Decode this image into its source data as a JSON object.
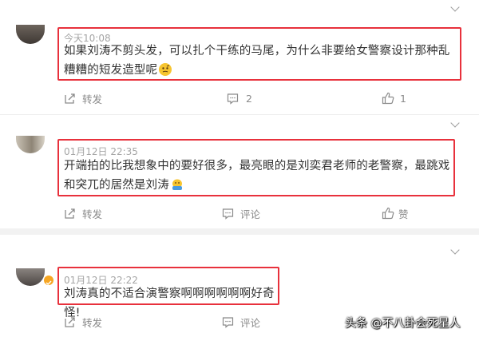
{
  "comments": [
    {
      "time": "今天10:08",
      "text": "如果刘涛不剪头发，可以扎个干练的马尾，为什么非要给女警察设计那种乱糟糟的短发造型呢",
      "emoji": "thinking-face",
      "actions": {
        "forward": "转发",
        "comment": "2",
        "like": "1"
      }
    },
    {
      "time": "01月12日 22:35",
      "text": "开端拍的比我想象中的要好很多，最亮眼的是刘奕君老师的老警察，最跳戏和突兀的居然是刘涛",
      "emoji": "melting-face",
      "actions": {
        "forward": "转发",
        "comment": "评论",
        "like": "赞"
      }
    },
    {
      "time": "01月12日 22:22",
      "text": "刘涛真的不适合演警察啊啊啊啊啊啊好奇怪!",
      "actions": {
        "forward": "转发",
        "comment": "评论",
        "like": "赞"
      }
    }
  ],
  "watermark": "头条 @不八卦会死星人",
  "colors": {
    "highlight": "#e8313c",
    "time": "#a5a5a5",
    "text": "#333333",
    "action": "#8a8a8a"
  }
}
